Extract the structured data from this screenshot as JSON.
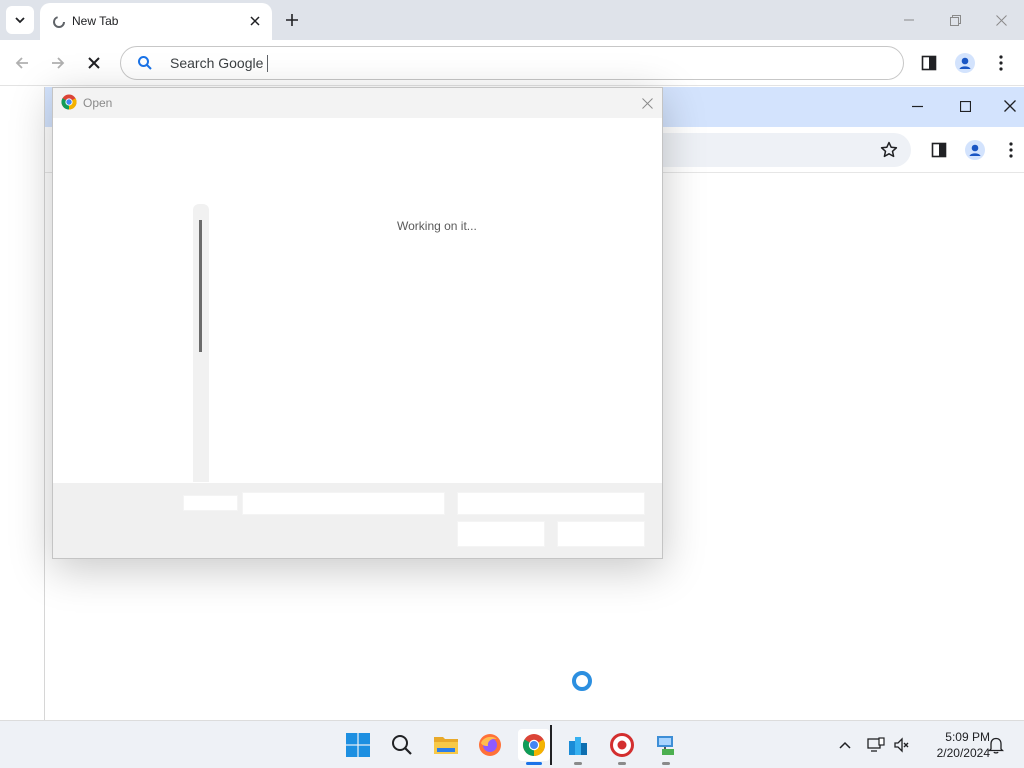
{
  "browser": {
    "tab_title": "New Tab",
    "search_placeholder": "Search Google"
  },
  "dialog": {
    "title": "Open",
    "status_text": "Working on it..."
  },
  "taskbar": {
    "apps": [
      "start",
      "search",
      "file-explorer",
      "firefox",
      "chrome",
      "app-cubes",
      "app-red-circle",
      "app-network"
    ],
    "clock_time": "5:09 PM",
    "clock_date": "2/20/2024"
  },
  "colors": {
    "accent": "#1a73e8",
    "secondary_titlebar": "#d3e3fd",
    "spinner": "#2c8fe0"
  }
}
